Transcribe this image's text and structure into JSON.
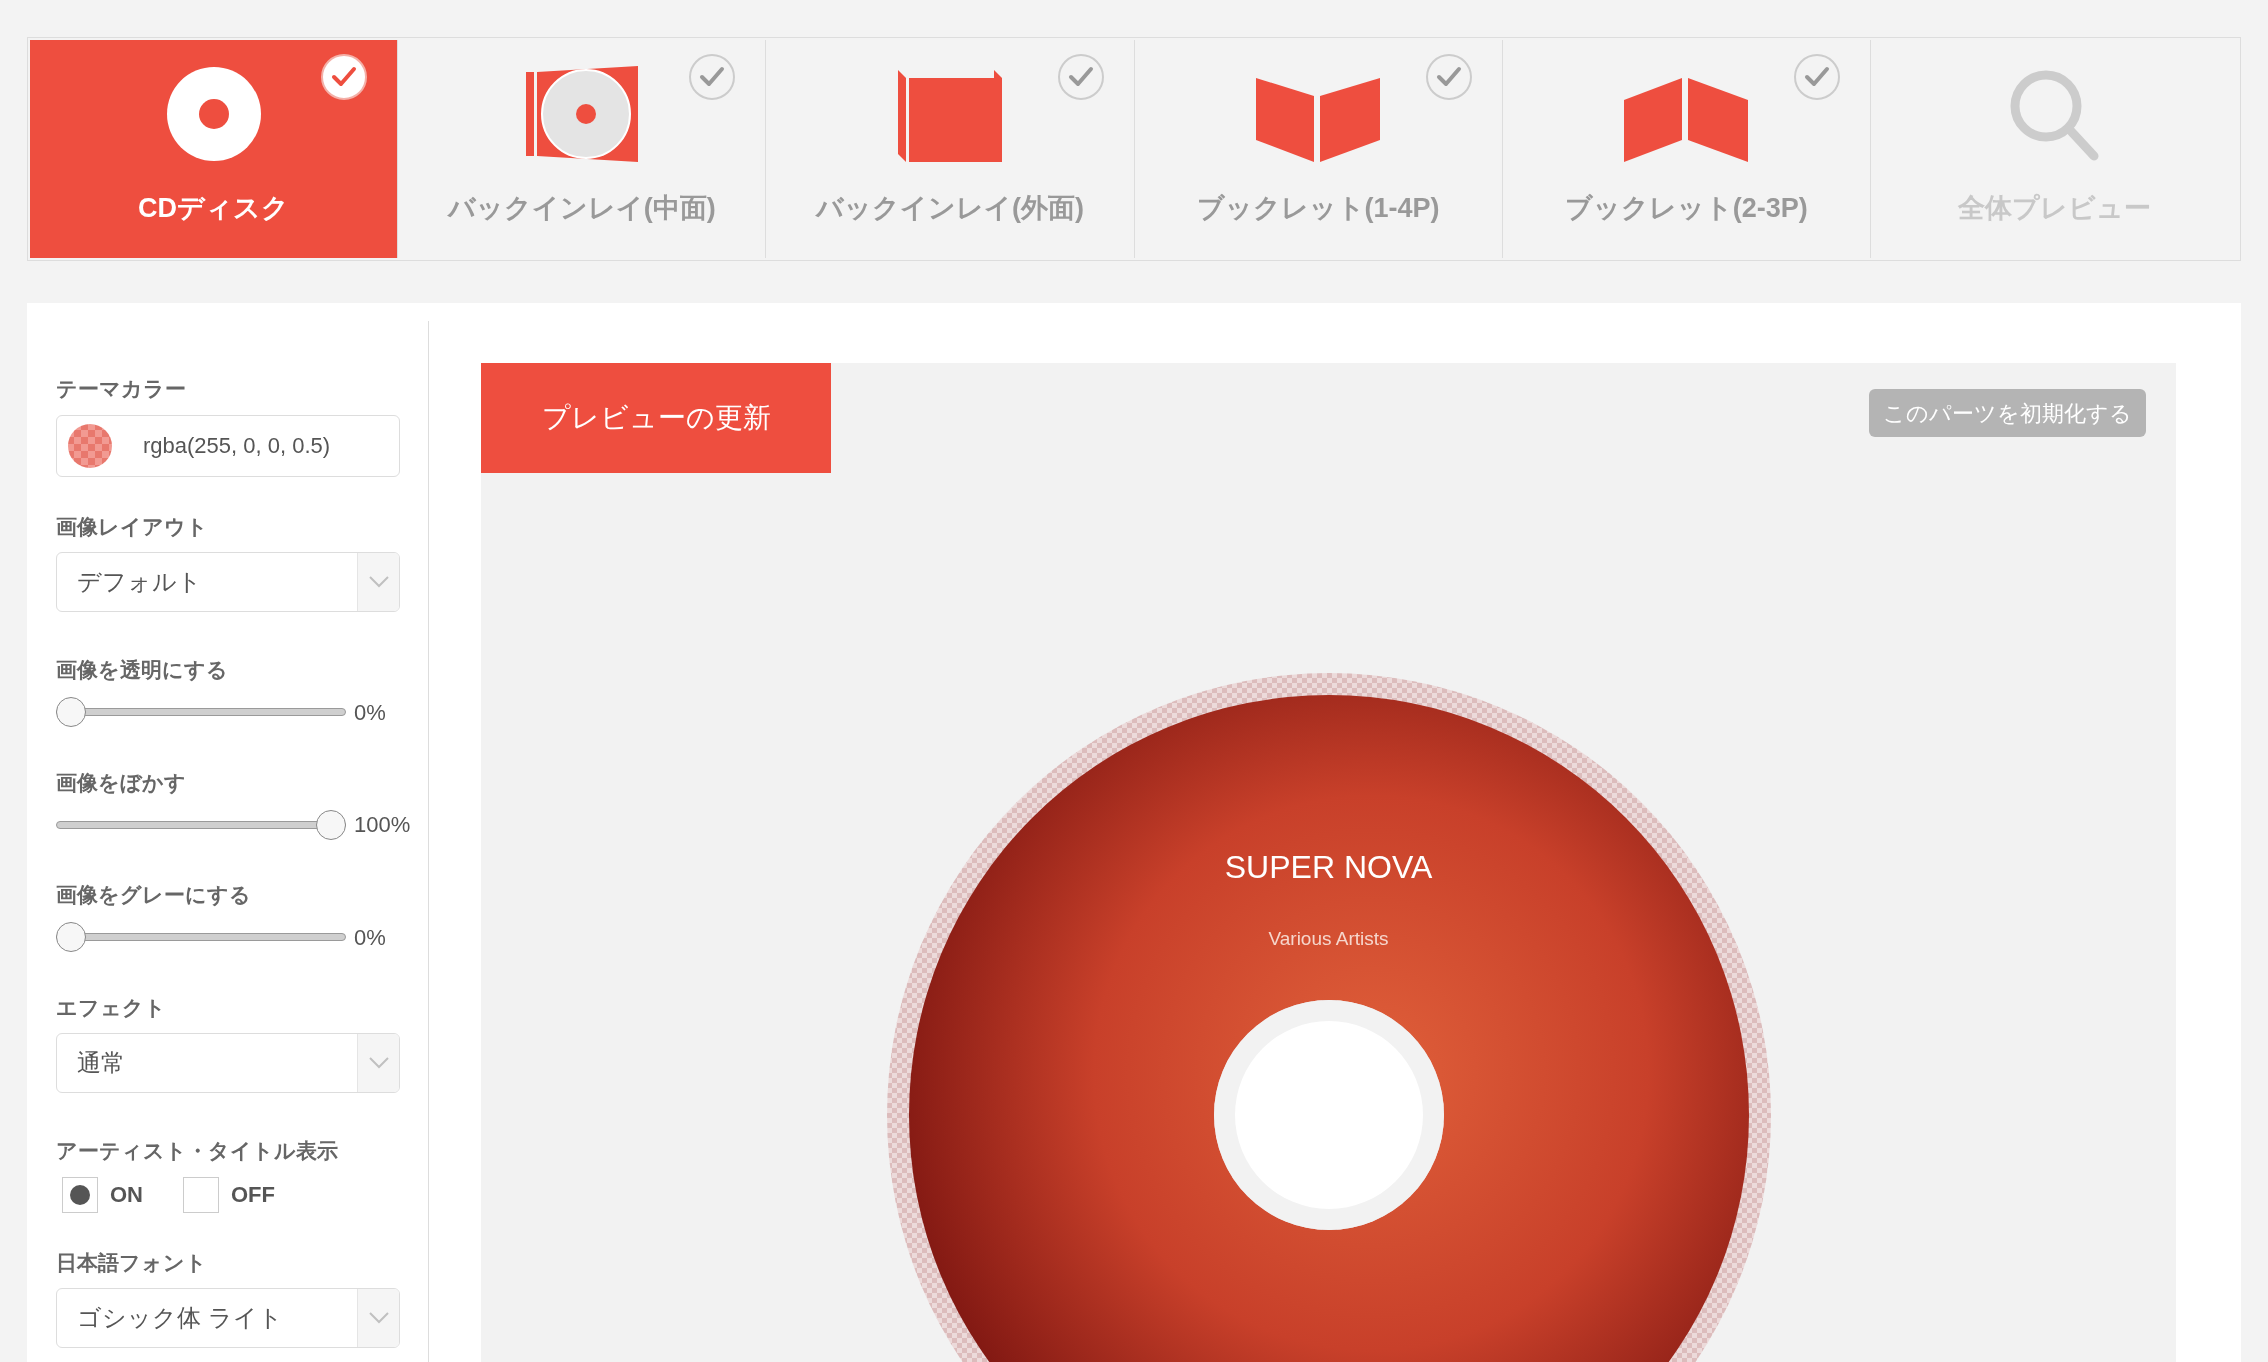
{
  "tabs": [
    {
      "label": "CDディスク",
      "kind": "disc",
      "selected": true,
      "checked": true,
      "disabled": false
    },
    {
      "label": "バックインレイ(中面)",
      "kind": "inlay-inner",
      "selected": false,
      "checked": true,
      "disabled": false
    },
    {
      "label": "バックインレイ(外面)",
      "kind": "inlay-outer",
      "selected": false,
      "checked": true,
      "disabled": false
    },
    {
      "label": "ブックレット(1-4P)",
      "kind": "booklet-outer",
      "selected": false,
      "checked": true,
      "disabled": false
    },
    {
      "label": "ブックレット(2-3P)",
      "kind": "booklet-inner",
      "selected": false,
      "checked": true,
      "disabled": false
    },
    {
      "label": "全体プレビュー",
      "kind": "preview",
      "selected": false,
      "checked": false,
      "disabled": true
    }
  ],
  "sidebar": {
    "controls": [
      {
        "kind": "color",
        "label": "テーマカラー",
        "value": "rgba(255, 0, 0, 0.5)"
      },
      {
        "kind": "select",
        "label": "画像レイアウト",
        "value": "デフォルト"
      },
      {
        "kind": "slider",
        "label": "画像を透明にする",
        "level": 0,
        "reading": "0%"
      },
      {
        "kind": "slider",
        "label": "画像をぼかす",
        "level": 1,
        "reading": "100%"
      },
      {
        "kind": "slider",
        "label": "画像をグレーにする",
        "level": 0,
        "reading": "0%"
      },
      {
        "kind": "select",
        "label": "エフェクト",
        "value": "通常"
      },
      {
        "kind": "radio",
        "label": "アーティスト・タイトル表示",
        "options": [
          {
            "label": "ON",
            "selected": true
          },
          {
            "label": "OFF",
            "selected": false
          }
        ]
      },
      {
        "kind": "select",
        "label": "日本語フォント",
        "value": "ゴシック体 ライト"
      }
    ]
  },
  "preview": {
    "update_button": "プレビューの更新",
    "reset_button": "このパーツを初期化する",
    "disc": {
      "title": "SUPER NOVA",
      "artist": "Various Artists"
    }
  }
}
